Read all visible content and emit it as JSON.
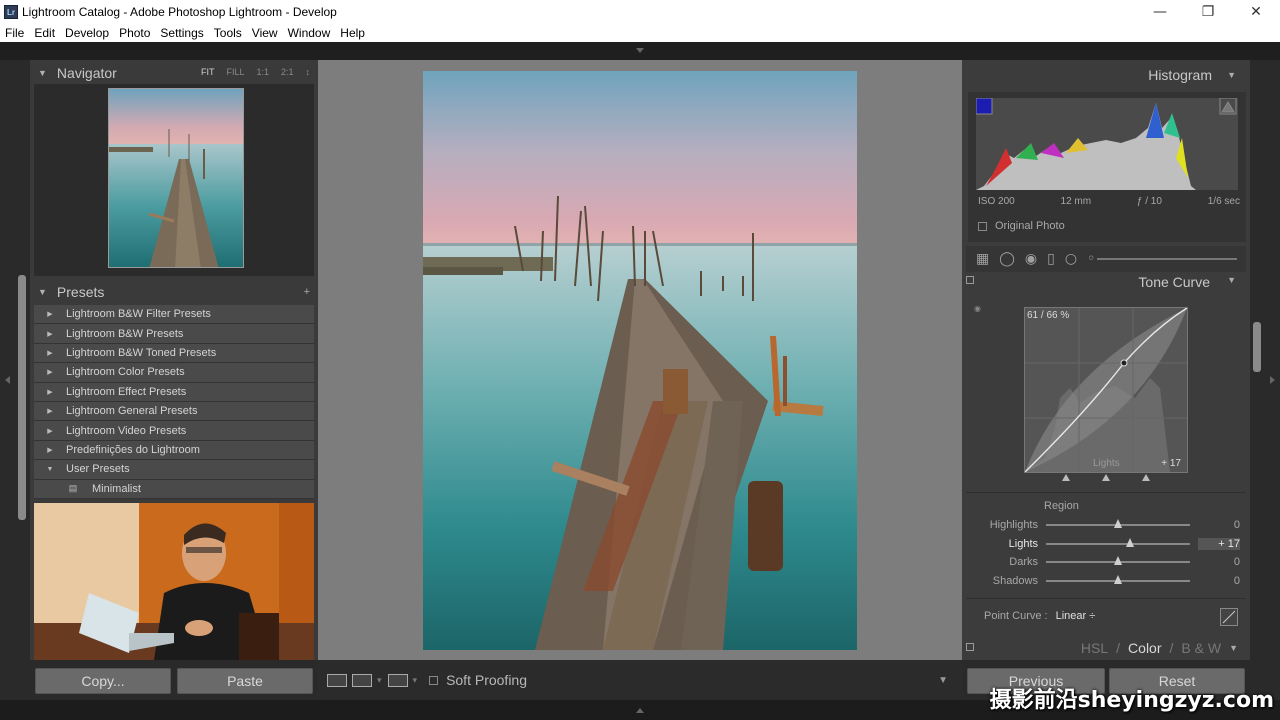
{
  "window": {
    "title": "Lightroom Catalog - Adobe Photoshop Lightroom - Develop",
    "app_icon": "Lr"
  },
  "menu": [
    "File",
    "Edit",
    "Develop",
    "Photo",
    "Settings",
    "Tools",
    "View",
    "Window",
    "Help"
  ],
  "navigator": {
    "title": "Navigator",
    "zoom_options": [
      "FIT",
      "FILL",
      "1:1",
      "2:1"
    ]
  },
  "presets": {
    "title": "Presets",
    "add_symbol": "+",
    "items": [
      "Lightroom B&W Filter Presets",
      "Lightroom B&W Presets",
      "Lightroom B&W Toned Presets",
      "Lightroom Color Presets",
      "Lightroom Effect Presets",
      "Lightroom General Presets",
      "Lightroom Video Presets",
      "Predefinições do Lightroom",
      "User Presets"
    ],
    "child_items": [
      "Minimalist"
    ]
  },
  "left_buttons": {
    "copy": "Copy...",
    "paste": "Paste"
  },
  "toolbar": {
    "soft_proofing": "Soft Proofing"
  },
  "histogram": {
    "title": "Histogram",
    "iso": "ISO 200",
    "focal": "12 mm",
    "aperture": "ƒ / 10",
    "shutter": "1/6 sec",
    "original_photo": "Original Photo"
  },
  "tone_curve": {
    "title": "Tone Curve",
    "readout": "61 / 66 %",
    "hover_region": "Lights",
    "hover_value": "+ 17",
    "region_label": "Region",
    "sliders": [
      {
        "label": "Highlights",
        "value": "0",
        "position": 0.5
      },
      {
        "label": "Lights",
        "value": "+ 17",
        "position": 0.585
      },
      {
        "label": "Darks",
        "value": "0",
        "position": 0.5
      },
      {
        "label": "Shadows",
        "value": "0",
        "position": 0.5
      }
    ],
    "point_curve_label": "Point Curve :",
    "point_curve_value": "Linear ÷"
  },
  "panel_tabs": {
    "hsl": "HSL",
    "color": "Color",
    "bw": "B & W"
  },
  "right_buttons": {
    "previous": "Previous",
    "reset": "Reset"
  },
  "watermark": "摄影前沿sheyingzyz.com"
}
